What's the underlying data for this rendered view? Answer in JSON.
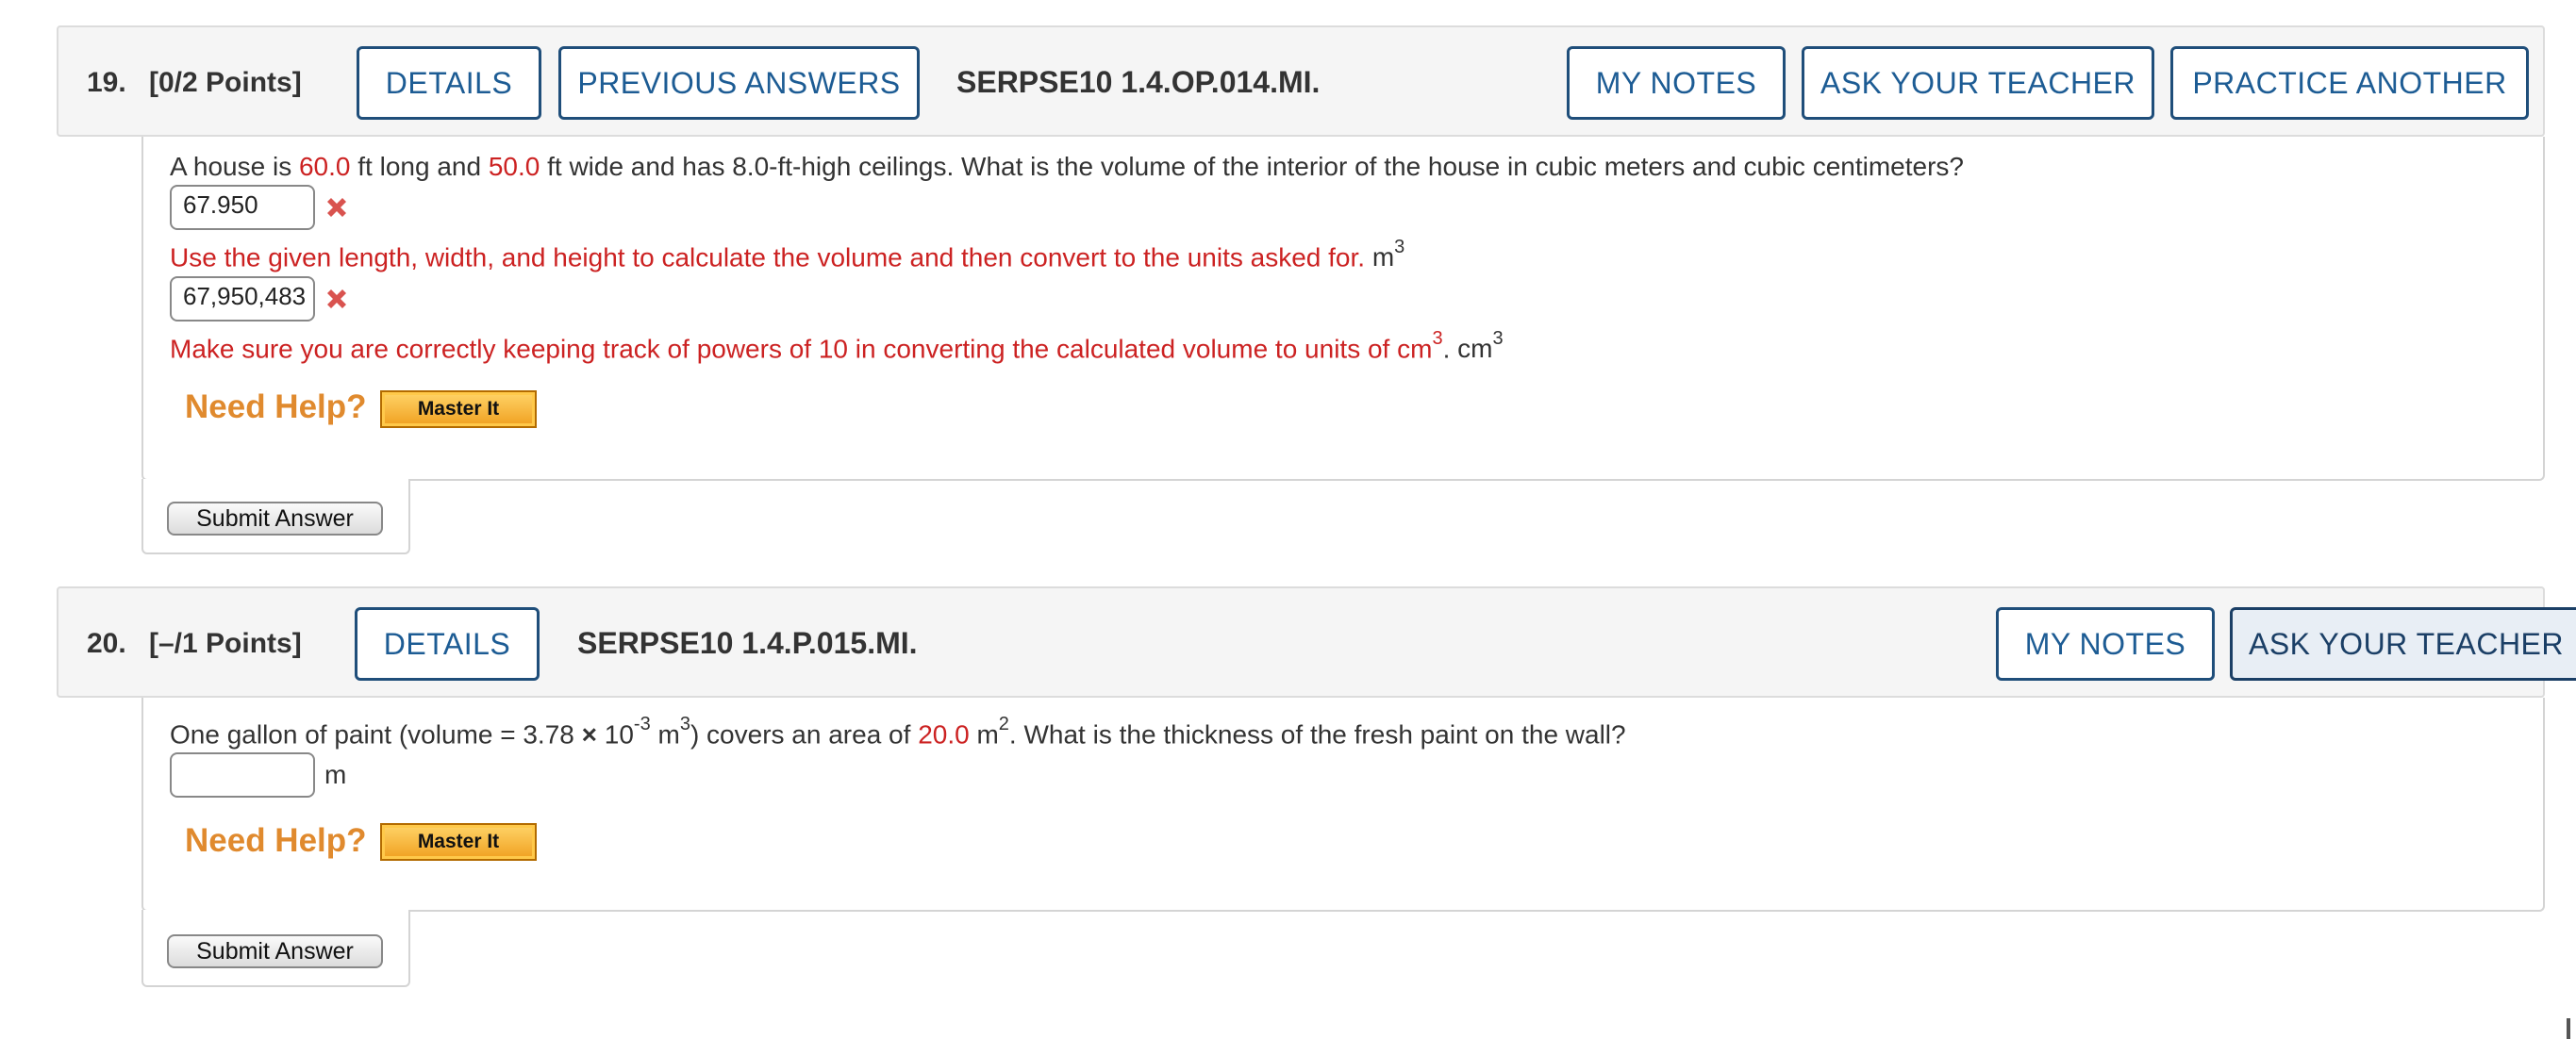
{
  "questions": [
    {
      "number": "19.",
      "points": "[0/2 Points]",
      "buttons": {
        "details": "DETAILS",
        "previous_answers": "PREVIOUS ANSWERS",
        "my_notes": "MY NOTES",
        "ask_teacher": "ASK YOUR TEACHER",
        "practice_another": "PRACTICE ANOTHER"
      },
      "code": "SERPSE10 1.4.OP.014.MI.",
      "text": {
        "p1": "A house is ",
        "length": "60.0",
        "p2": " ft long and ",
        "width": "50.0",
        "p3": " ft wide and has 8.0-ft-high ceilings. What is the volume of the interior of the house in cubic meters and cubic centimeters?"
      },
      "answers": [
        {
          "value": "67.950",
          "status": "incorrect",
          "feedback": "Use the given length, width, and height to calculate the volume and then convert to the units asked for.",
          "unit": "m",
          "unit_exp": "3"
        },
        {
          "value": "67,950,483",
          "status": "incorrect",
          "feedback": "Make sure you are correctly keeping track of powers of 10 in converting the calculated volume to units of cm",
          "feedback_exp": "3",
          "feedback_end": ".",
          "unit": "cm",
          "unit_exp": "3"
        }
      ],
      "need_help": "Need Help?",
      "master_it": "Master It",
      "submit": "Submit Answer"
    },
    {
      "number": "20.",
      "points": "[–/1 Points]",
      "buttons": {
        "details": "DETAILS",
        "my_notes": "MY NOTES",
        "ask_teacher": "ASK YOUR TEACHER"
      },
      "code": "SERPSE10 1.4.P.015.MI.",
      "text": {
        "p1": "One gallon of paint (volume = 3.78 ",
        "times": "×",
        "p2": " 10",
        "exp1": "-3",
        "p3": " m",
        "exp2": "3",
        "p4": ") covers an area of ",
        "area": "20.0",
        "p5": " m",
        "exp3": "2",
        "p6": ". What is the thickness of the fresh paint on the wall?"
      },
      "answers": [
        {
          "value": "",
          "unit": "m"
        }
      ],
      "need_help": "Need Help?",
      "master_it": "Master It",
      "submit": "Submit Answer"
    }
  ],
  "colors": {
    "accent": "#1d5c94",
    "incorrect": "#cc2222",
    "help": "#e08a2e"
  }
}
